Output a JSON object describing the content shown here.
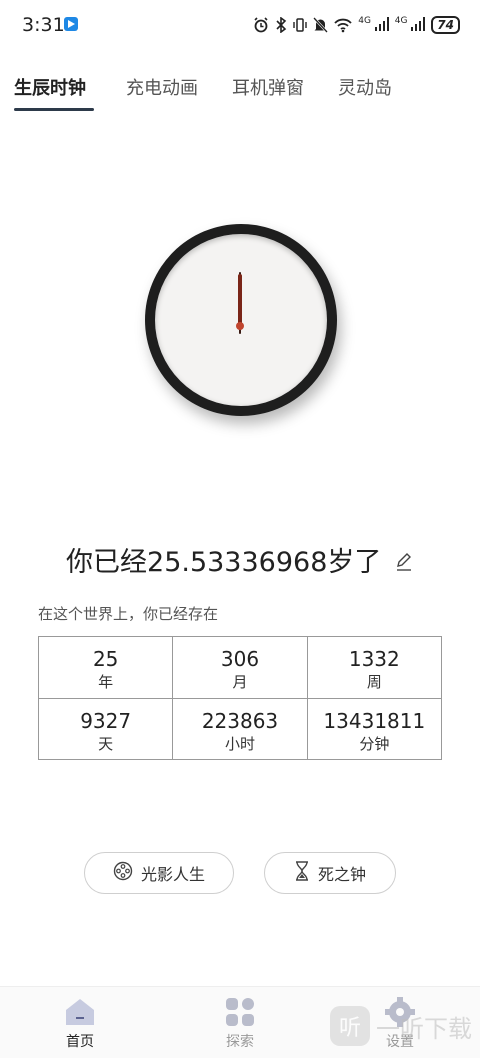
{
  "status_bar": {
    "time": "3:31",
    "signal_1": "4G",
    "signal_2": "4G",
    "battery": "74",
    "icons": [
      "alarm-icon",
      "bluetooth-icon",
      "vibrate-icon",
      "mute-icon",
      "wifi-icon",
      "signal-icon",
      "signal-icon",
      "battery-icon"
    ]
  },
  "tabs": [
    {
      "label": "生辰时钟",
      "active": true
    },
    {
      "label": "充电动画",
      "active": false
    },
    {
      "label": "耳机弹窗",
      "active": false
    },
    {
      "label": "灵动岛",
      "active": false
    }
  ],
  "age": {
    "prefix": "你已经",
    "value": "25.53336968",
    "suffix": "岁了"
  },
  "exist_text": "在这个世界上，你已经存在",
  "stats": [
    [
      {
        "value": "25",
        "unit": "年"
      },
      {
        "value": "306",
        "unit": "月"
      },
      {
        "value": "1332",
        "unit": "周"
      }
    ],
    [
      {
        "value": "9327",
        "unit": "天"
      },
      {
        "value": "223863",
        "unit": "小时"
      },
      {
        "value": "13431811",
        "unit": "分钟"
      }
    ]
  ],
  "buttons": {
    "light_life": "光影人生",
    "death_clock": "死之钟"
  },
  "bottom_nav": [
    {
      "label": "首页",
      "icon": "home-icon",
      "active": true
    },
    {
      "label": "探索",
      "icon": "grid-icon",
      "active": false
    },
    {
      "label": "设置",
      "icon": "gear-icon",
      "active": false
    }
  ],
  "watermark": {
    "logo": "听",
    "text": "一听下载"
  },
  "colors": {
    "tab_underline": "#2d3a4a",
    "clock_rim": "#1e1e1e",
    "clock_face": "#f4f3f2",
    "hand": "#7a2518"
  }
}
